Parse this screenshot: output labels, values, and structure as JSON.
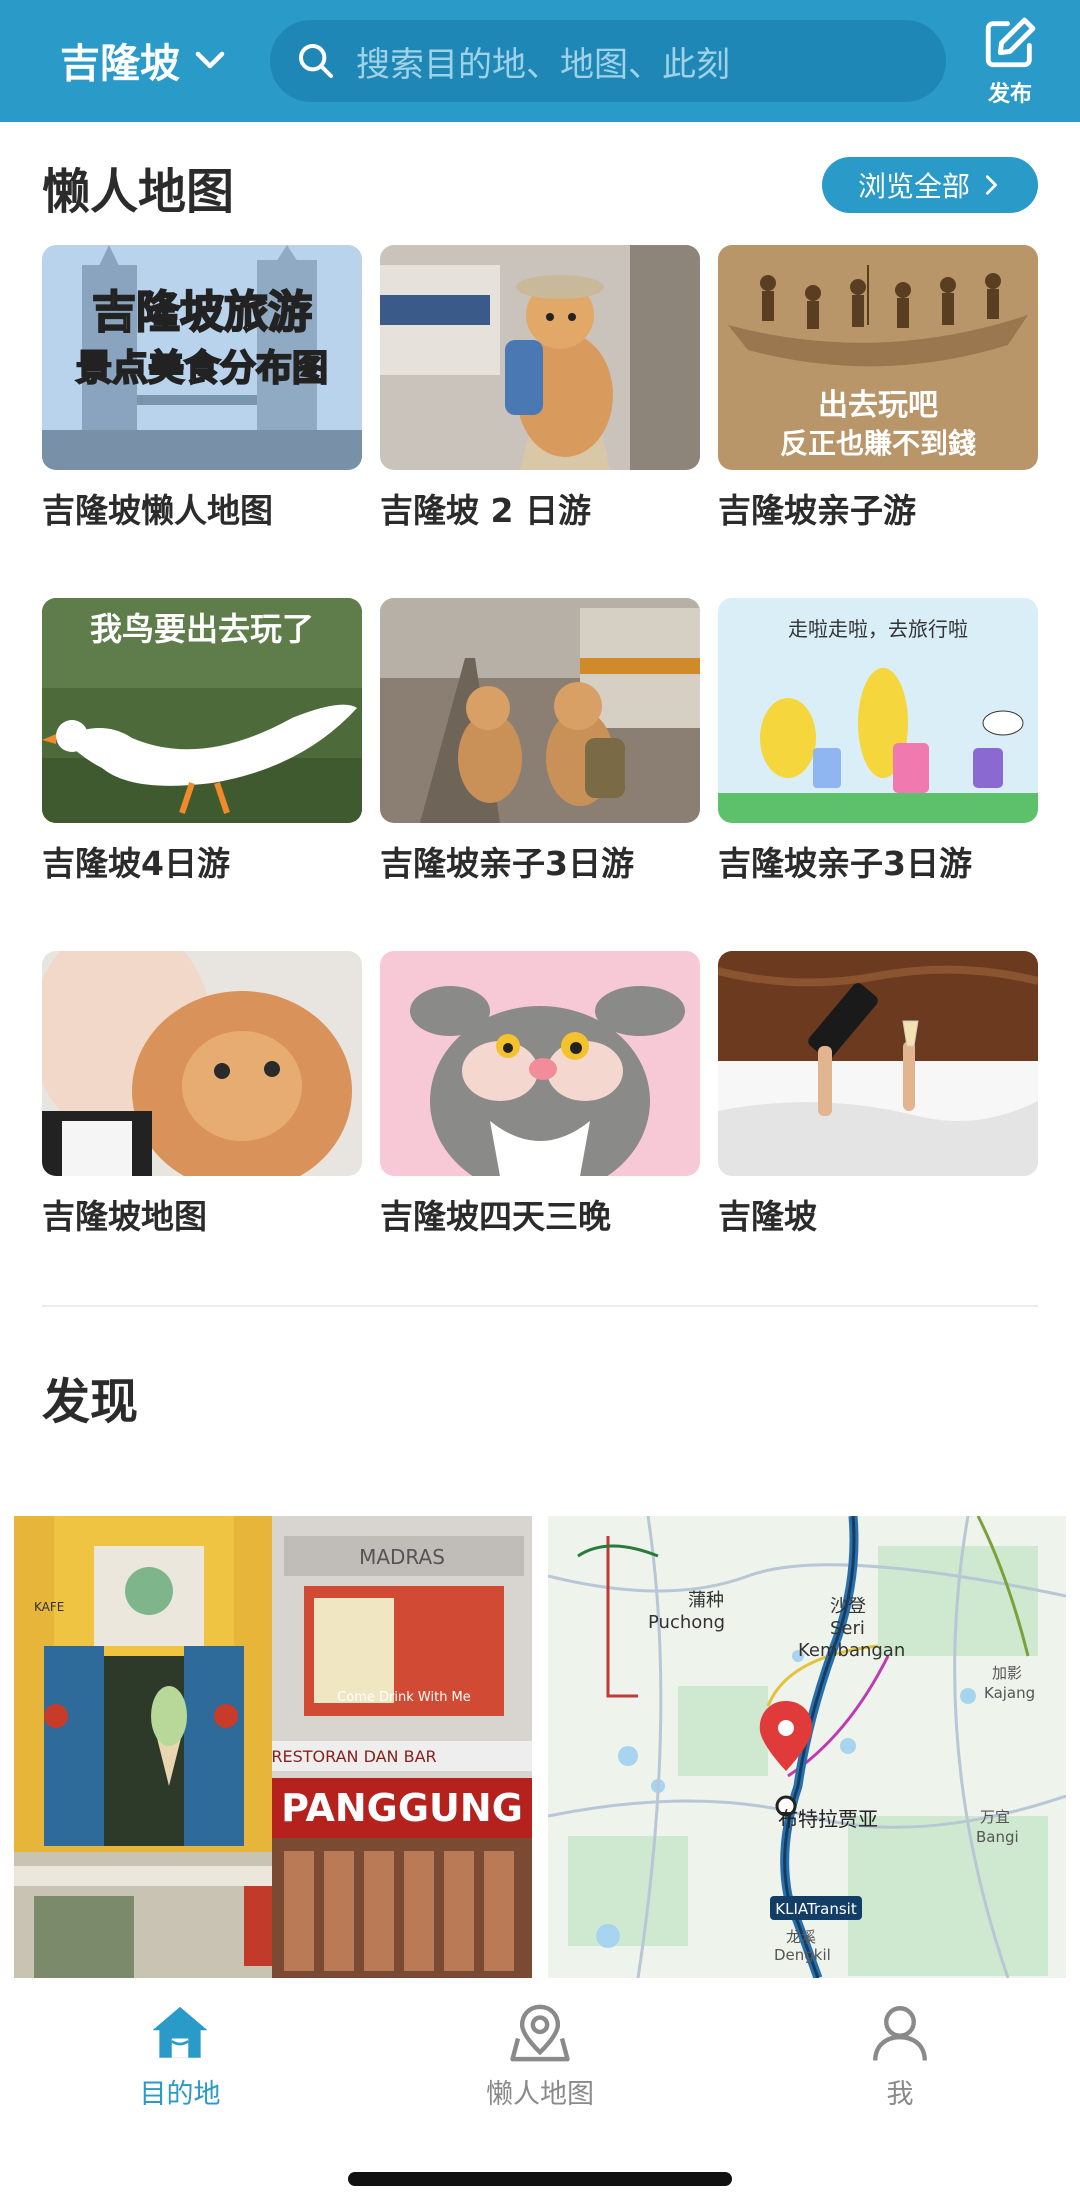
{
  "header": {
    "city": "吉隆坡",
    "search_placeholder": "搜索目的地、地图、此刻",
    "publish_label": "发布"
  },
  "lazy_maps": {
    "title": "懒人地图",
    "browse_all": "浏览全部",
    "cards": [
      {
        "caption": "吉隆坡懒人地图",
        "overlay_line1": "吉隆坡旅游",
        "overlay_line2": "景点美食分布图"
      },
      {
        "caption": "吉隆坡 2 日游"
      },
      {
        "caption": "吉隆坡亲子游",
        "overlay_line1": "出去玩吧",
        "overlay_line2": "反正也賺不到錢"
      },
      {
        "caption": "吉隆坡4日游",
        "overlay_line1": "我鸟要出去玩了"
      },
      {
        "caption": "吉隆坡亲子3日游"
      },
      {
        "caption": "吉隆坡亲子3日游",
        "overlay_line1": "走啦走啦，去旅行啦"
      },
      {
        "caption": "吉隆坡地图"
      },
      {
        "caption": "吉隆坡四天三晚"
      },
      {
        "caption": "吉隆坡"
      }
    ]
  },
  "discover": {
    "title": "发现",
    "photo_signs": {
      "madras": "MADRAS",
      "restoran": "RESTORAN DAN BAR",
      "panggung": "PANGGUNG",
      "poster": "Come Drink With Me",
      "kafe": "KAFE"
    },
    "map_labels": {
      "puchong_cn": "蒲种",
      "puchong": "Puchong",
      "seri_cn": "沙登",
      "seri": "Seri",
      "kembangan": "Kembangan",
      "kajang_cn": "加影",
      "kajang": "Kajang",
      "putrajaya_cn": "布特拉贾亚",
      "bangi_cn": "万宜",
      "bangi": "Bangi",
      "klia": "KLIATransit",
      "dengkil_cn": "龙溪",
      "dengkil": "Dengkil"
    }
  },
  "bottom_nav": {
    "items": [
      {
        "label": "目的地",
        "active": true
      },
      {
        "label": "懒人地图",
        "active": false
      },
      {
        "label": "我",
        "active": false
      }
    ],
    "active_color": "#2a9ac9",
    "inactive_color": "#8a8a8a"
  },
  "colors": {
    "brand": "#2a9ac9"
  }
}
